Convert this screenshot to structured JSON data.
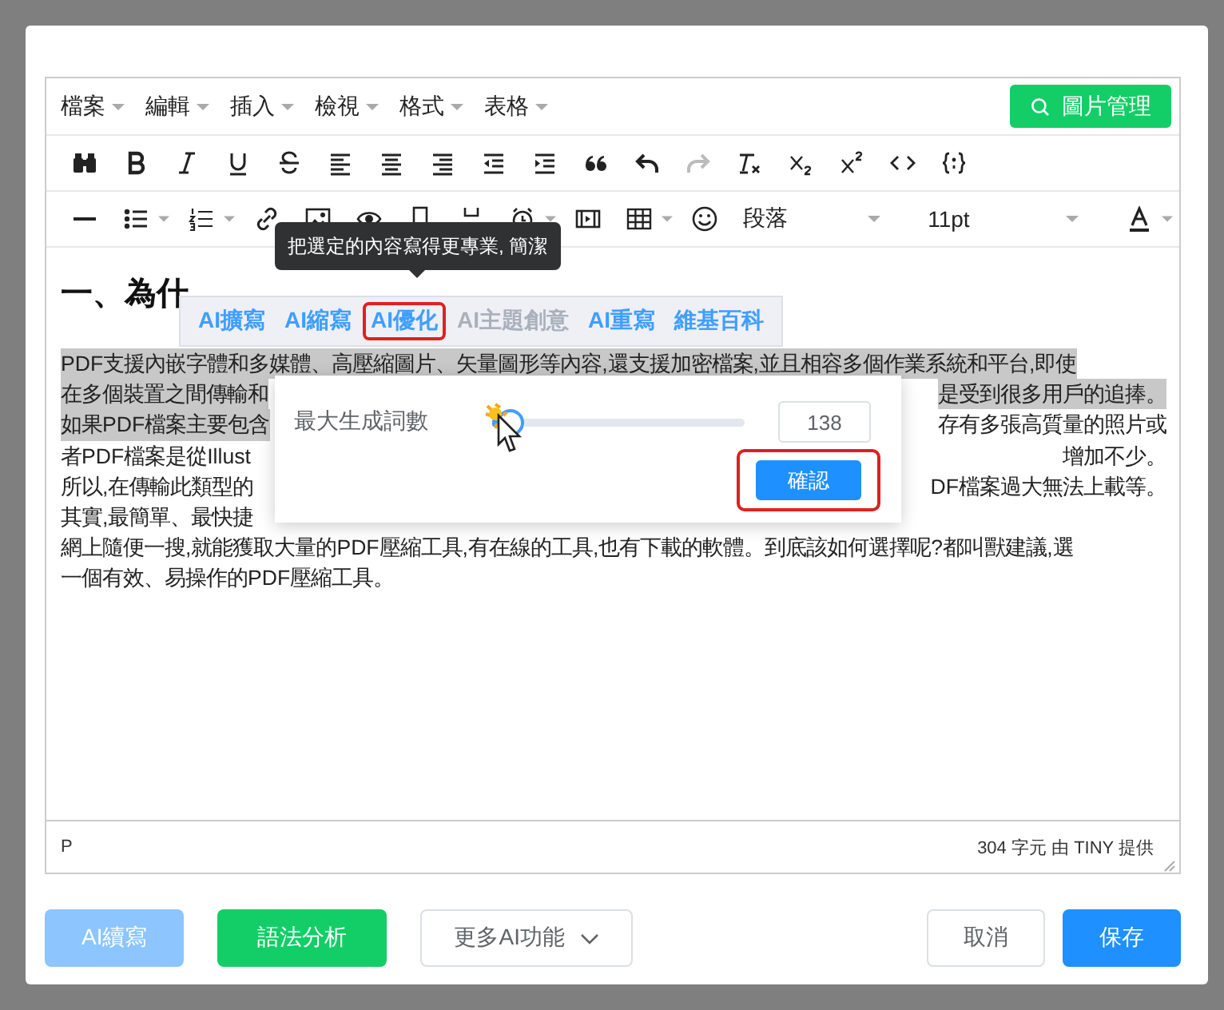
{
  "editor": {
    "menus": [
      {
        "label": "檔案"
      },
      {
        "label": "編輯"
      },
      {
        "label": "插入"
      },
      {
        "label": "檢視"
      },
      {
        "label": "格式"
      },
      {
        "label": "表格"
      }
    ],
    "image_manager_button": "圖片管理",
    "toolbar_row_1": [
      {
        "kind": "find",
        "disabled": false
      },
      {
        "kind": "bold",
        "disabled": false
      },
      {
        "kind": "italic",
        "disabled": false
      },
      {
        "kind": "underline",
        "disabled": false
      },
      {
        "kind": "strike",
        "disabled": false
      },
      {
        "kind": "align-left",
        "disabled": false
      },
      {
        "kind": "align-center",
        "disabled": false
      },
      {
        "kind": "align-right",
        "disabled": false
      },
      {
        "kind": "outdent",
        "disabled": false
      },
      {
        "kind": "indent",
        "disabled": false
      },
      {
        "kind": "quote",
        "disabled": false
      },
      {
        "kind": "undo",
        "disabled": false
      },
      {
        "kind": "redo",
        "disabled": true
      },
      {
        "kind": "clear-format",
        "disabled": false
      },
      {
        "kind": "subscript",
        "disabled": false
      },
      {
        "kind": "superscript",
        "disabled": false
      },
      {
        "kind": "code",
        "disabled": false
      },
      {
        "kind": "template",
        "disabled": false
      }
    ],
    "toolbar_row_2": [
      {
        "kind": "hr",
        "disabled": false
      },
      {
        "kind": "bullet-list",
        "disabled": false
      },
      {
        "kind": "numbered-list",
        "disabled": false
      },
      {
        "kind": "link",
        "disabled": false
      },
      {
        "kind": "image",
        "disabled": false
      },
      {
        "kind": "preview",
        "disabled": false
      },
      {
        "kind": "page",
        "disabled": false
      },
      {
        "kind": "page-break",
        "disabled": false
      },
      {
        "kind": "clock",
        "disabled": false
      },
      {
        "kind": "media",
        "disabled": false
      },
      {
        "kind": "table",
        "disabled": false
      },
      {
        "kind": "emoji",
        "disabled": false
      }
    ],
    "block_format": "段落",
    "font_size": "11pt",
    "heading": "一、為什",
    "lines": [
      {
        "segments": [
          {
            "text": "PDF支援內嵌字體和多媒體、高壓縮圖片、矢量圖形等內容,還支援加密檔案,並且相容多個作業系統和平台,即使",
            "selected": true
          }
        ]
      },
      {
        "segments": [
          {
            "text": "在多個裝置之間傳輸和",
            "selected": true
          },
          {
            "text": "是受到很多用戶的追捧。",
            "selected": true
          }
        ]
      },
      {
        "segments": [
          {
            "text": "如果PDF檔案主要包含",
            "selected": true
          },
          {
            "text": "存有多張高質量的照片或",
            "selected": false
          }
        ]
      },
      {
        "segments": [
          {
            "text": "者PDF檔案是從Illust",
            "selected": false
          },
          {
            "text": "增加不少。",
            "selected": false
          }
        ]
      },
      {
        "segments": [
          {
            "text": "所以,在傳輸此類型的",
            "selected": false
          },
          {
            "text": "DF檔案過大無法上載等。",
            "selected": false
          }
        ]
      },
      {
        "segments": [
          {
            "text": "其實,最簡單、最快捷",
            "selected": false
          }
        ]
      },
      {
        "segments": [
          {
            "text": "網上隨便一搜,就能獲取大量的PDF壓縮工具,有在線的工具,也有下載的軟體。到底該如何選擇呢?都叫獸建議,選",
            "selected": false
          }
        ]
      },
      {
        "segments": [
          {
            "text": "一個有效、易操作的PDF壓縮工具。",
            "selected": false
          }
        ]
      }
    ],
    "tooltip": "把選定的內容寫得更專業, 簡潔",
    "ai_toolbar": [
      {
        "label": "AI擴寫",
        "selected": false,
        "disabled": false
      },
      {
        "label": "AI縮寫",
        "selected": false,
        "disabled": false
      },
      {
        "label": "AI優化",
        "selected": true,
        "disabled": false
      },
      {
        "label": "AI主題創意",
        "selected": false,
        "disabled": true
      },
      {
        "label": "AI重寫",
        "selected": false,
        "disabled": false
      },
      {
        "label": "維基百科",
        "selected": false,
        "disabled": false
      }
    ],
    "popup": {
      "label": "最大生成詞數",
      "slider": {
        "level": 0.02
      },
      "value": "138",
      "confirm": "確認",
      "confirm_highlighted": true
    },
    "status_path": "P",
    "status_count": "304 字元 由 TINY 提供"
  },
  "footer": {
    "left": [
      {
        "label": "AI續寫",
        "kind": "primary-light",
        "disabled": true
      },
      {
        "label": "語法分析",
        "kind": "success",
        "disabled": false
      },
      {
        "label": "更多AI功能",
        "kind": "dropdown",
        "disabled": false
      }
    ],
    "right": [
      {
        "label": "取消",
        "kind": "default",
        "disabled": false
      },
      {
        "label": "保存",
        "kind": "primary",
        "disabled": false
      }
    ]
  }
}
